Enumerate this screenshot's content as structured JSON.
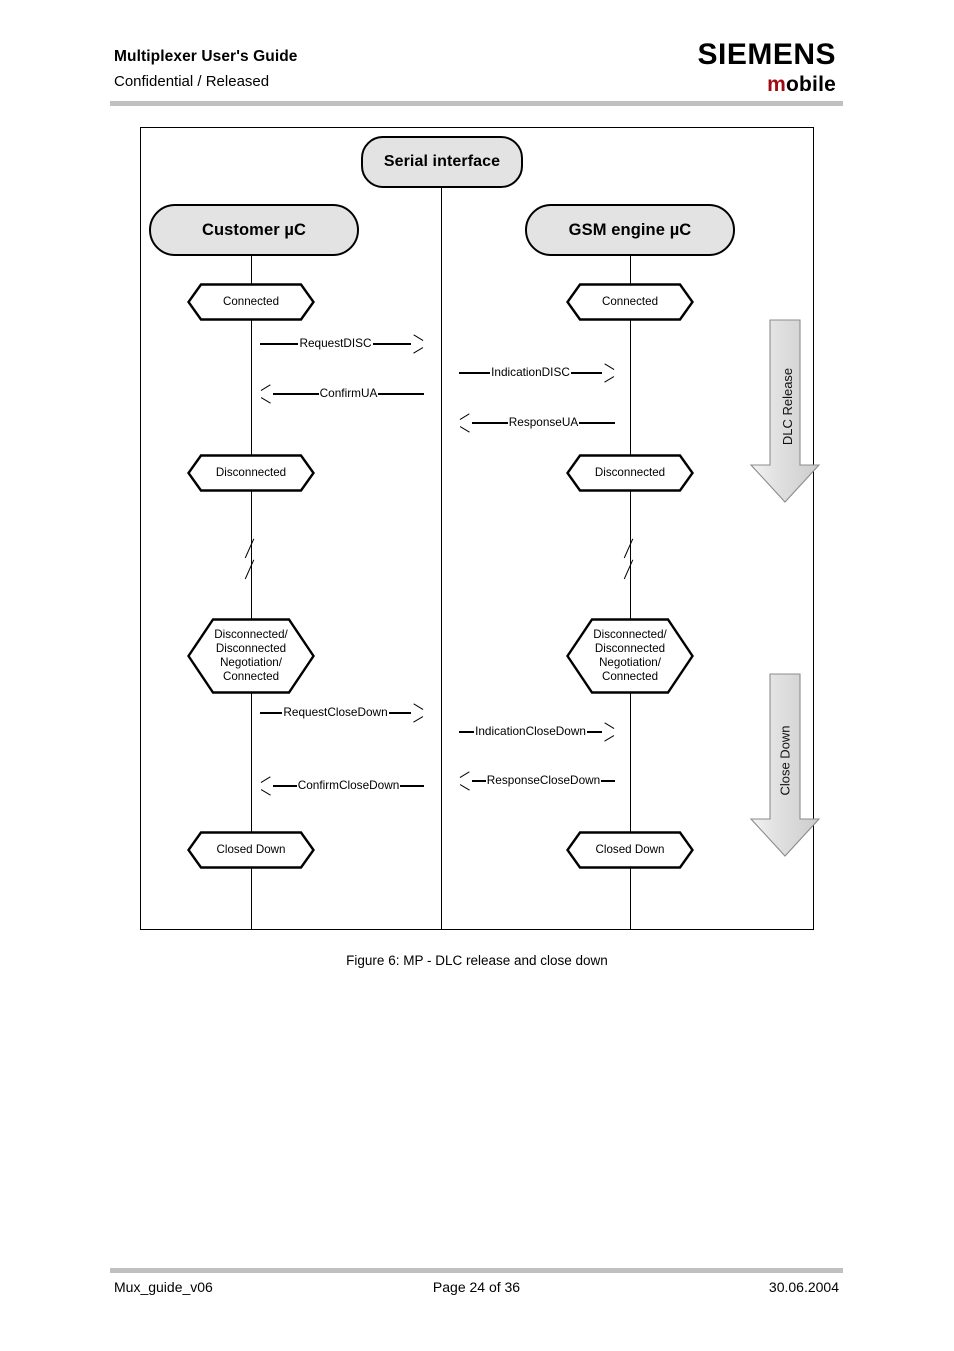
{
  "header": {
    "title": "Multiplexer User's Guide",
    "subtitle": "Confidential / Released",
    "brand_main": "SIEMENS",
    "brand_sub_accent": "m",
    "brand_sub_rest": "obile",
    "accent_color": "#9e0b13"
  },
  "figure": {
    "caption": "Figure 6: MP - DLC release and close down",
    "serial_interface": "Serial interface",
    "actors": [
      {
        "id": "customer",
        "label": "Customer µC"
      },
      {
        "id": "gsm",
        "label": "GSM engine µC"
      }
    ],
    "left_states": [
      {
        "label": "Connected"
      },
      {
        "label": "Disconnected"
      },
      {
        "label_lines": "Disconnected/\nDisconnected\nNegotiation/\nConnected"
      },
      {
        "label": "Closed Down"
      }
    ],
    "right_states": [
      {
        "label": "Connected"
      },
      {
        "label": "Disconnected"
      },
      {
        "label_lines": "Disconnected/\nDisconnected\nNegotiation/\nConnected"
      },
      {
        "label": "Closed Down"
      }
    ],
    "left_messages": [
      {
        "label": "RequestDISC",
        "direction": "right"
      },
      {
        "label": "ConfirmUA",
        "direction": "left"
      },
      {
        "label": "RequestCloseDown",
        "direction": "right"
      },
      {
        "label": "ConfirmCloseDown",
        "direction": "left"
      }
    ],
    "right_messages": [
      {
        "label": "IndicationDISC",
        "direction": "right"
      },
      {
        "label": "ResponseUA",
        "direction": "left"
      },
      {
        "label": "IndicationCloseDown",
        "direction": "right"
      },
      {
        "label": "ResponseCloseDown",
        "direction": "left"
      }
    ],
    "phases": [
      {
        "label": "DLC Release"
      },
      {
        "label": "Close Down"
      }
    ]
  },
  "footer": {
    "document": "Mux_guide_v06",
    "page": "Page 24 of 36",
    "date": "30.06.2004"
  }
}
